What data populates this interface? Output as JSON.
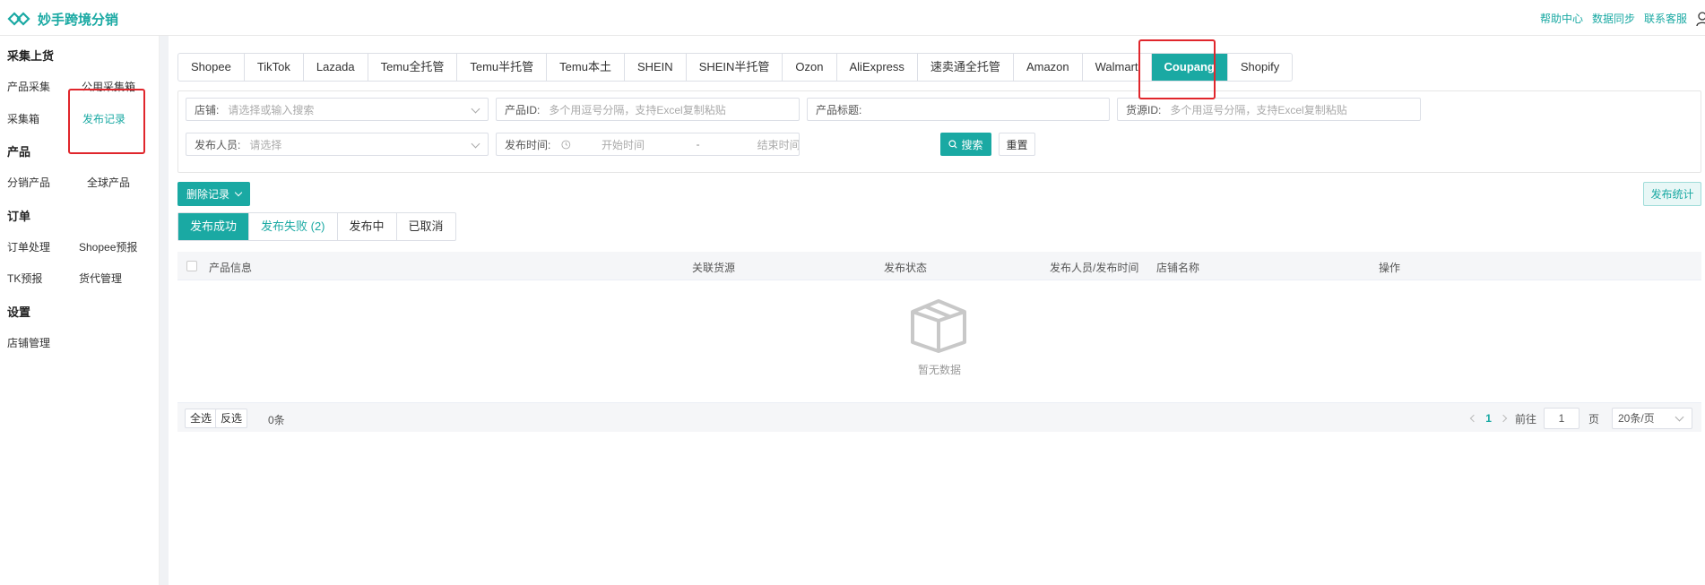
{
  "app": {
    "title": "妙手跨境分销"
  },
  "header": {
    "links": [
      "帮助中心",
      "数据同步",
      "联系客服"
    ]
  },
  "sidebar": {
    "sections": [
      "采集上货",
      "产品",
      "订单",
      "设置"
    ],
    "items": [
      "产品采集",
      "公用采集箱",
      "采集箱",
      "发布记录",
      "分销产品",
      "全球产品",
      "订单处理",
      "Shopee预报",
      "TK预报",
      "货代管理",
      "店铺管理"
    ]
  },
  "platform_tabs": [
    "Shopee",
    "TikTok",
    "Lazada",
    "Temu全托管",
    "Temu半托管",
    "Temu本土",
    "SHEIN",
    "SHEIN半托管",
    "Ozon",
    "AliExpress",
    "速卖通全托管",
    "Amazon",
    "Walmart",
    "Coupang",
    "Shopify"
  ],
  "active_platform": "Coupang",
  "filters": {
    "shop": {
      "label": "店铺:",
      "placeholder": "请选择或输入搜索"
    },
    "product_id": {
      "label": "产品ID:",
      "placeholder": "多个用逗号分隔，支持Excel复制粘贴"
    },
    "product_title": {
      "label": "产品标题:",
      "placeholder": ""
    },
    "source_id": {
      "label": "货源ID:",
      "placeholder": "多个用逗号分隔，支持Excel复制粘贴"
    },
    "publisher": {
      "label": "发布人员:",
      "placeholder": "请选择"
    },
    "publish_time": {
      "label": "发布时间:",
      "start": "开始时间",
      "sep": "-",
      "end": "结束时间"
    },
    "search_label": "搜索",
    "reset_label": "重置"
  },
  "actions": {
    "delete_label": "删除记录",
    "stats_label": "发布统计"
  },
  "status_tabs": [
    "发布成功",
    "发布失败 (2)",
    "发布中",
    "已取消"
  ],
  "table": {
    "columns": [
      "产品信息",
      "关联货源",
      "发布状态",
      "发布人员/发布时间",
      "店铺名称",
      "操作"
    ],
    "empty_text": "暂无数据"
  },
  "footer": {
    "select_all": "全选",
    "invert": "反选",
    "count": "0条",
    "page": "1",
    "goto_label": "前往",
    "goto_value": "1",
    "page_unit": "页",
    "page_size": "20条/页"
  },
  "colors": {
    "accent": "#1aa9a3",
    "highlight": "#e0262c"
  }
}
